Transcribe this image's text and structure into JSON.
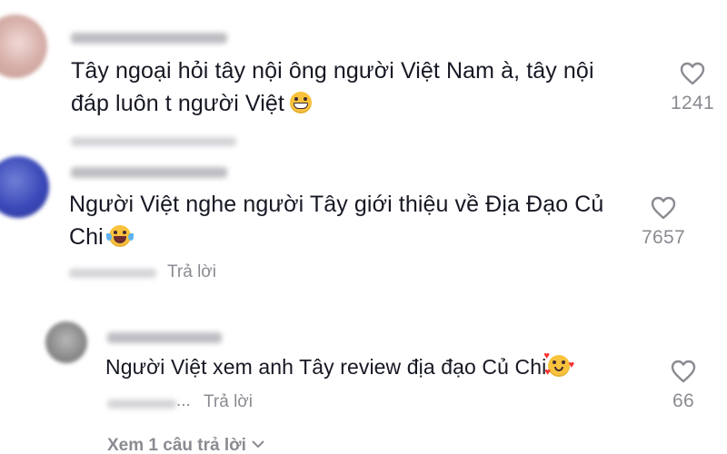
{
  "comments": [
    {
      "text": "Tây ngoại hỏi tây nội ông người Việt Nam à, tây nội đáp luôn t người Việt",
      "text_line1": "Tây ngoại hỏi tây nội ông người Việt Nam à, tây nội",
      "text_line2": "đáp luôn t người Việt",
      "emoji": "grinning-face-icon",
      "likes": "1241"
    },
    {
      "text": "Người Việt nghe người Tây giới thiệu về Địa Đạo Củ Chi",
      "text_line1": "Người Việt nghe người Tây giới thiệu về Địa Đạo Củ",
      "text_line2": "Chi",
      "emoji": "tears-of-joy-icon",
      "likes": "7657",
      "reply_label": "Trả lời"
    }
  ],
  "reply": {
    "text": "Người Việt xem anh Tây review địa đạo Củ Chi",
    "emoji": "smiling-face-with-hearts-icon",
    "likes": "66",
    "ellipsis": "...",
    "reply_label": "Trả lời"
  },
  "view_more_label": "Xem 1 câu trả lời",
  "colors": {
    "text": "#161823",
    "muted": "#8a8b91",
    "emoji_yellow": "#f9c23c"
  }
}
